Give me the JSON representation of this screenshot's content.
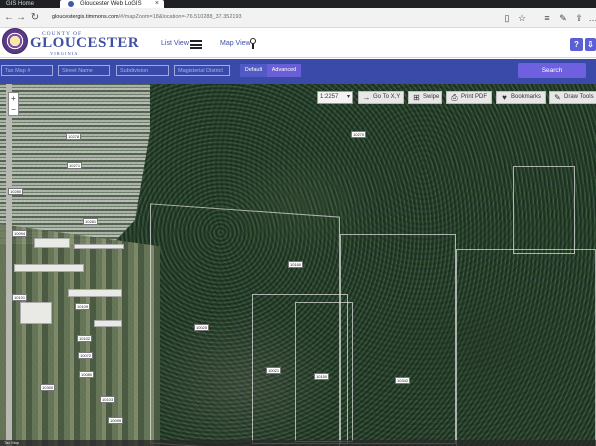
{
  "browser": {
    "tabs": [
      {
        "label": "GIS Home"
      },
      {
        "label": "Gloucester Web LoGIS"
      }
    ],
    "url_prefix": "gloucestergis.timmons.com",
    "url_rest": "/#/mapZoom=18&location=-76.510288_37.352193"
  },
  "header": {
    "brand_top": "COUNTY OF",
    "brand_name": "GLOUCESTER",
    "brand_sub": "VIRGINIA",
    "list_view_label": "List View",
    "map_view_label": "Map View",
    "help_glyph": "?"
  },
  "search": {
    "tax_map_placeholder": "Tax Map #",
    "street_name_placeholder": "Street Name",
    "subdivision_placeholder": "Subdivision",
    "magisterial_placeholder": "Magisterial District",
    "default_label": "Default",
    "advanced_label": "Advanced",
    "search_button": "Search"
  },
  "map": {
    "scale_value": "1:2257",
    "tools": {
      "goto_label": "Go To X,Y",
      "swipe_label": "Swipe",
      "print_label": "Print PDF",
      "bookmarks_label": "Bookmarks",
      "draw_label": "Draw Tools"
    },
    "parcel_labels": [
      "10270",
      "10278",
      "10271",
      "10280",
      "10281",
      "10025",
      "10021",
      "10160",
      "10150",
      "10342",
      "10109",
      "10102",
      "10072",
      "10080",
      "10103",
      "10099",
      "10094",
      "10101",
      "10300"
    ],
    "status_text": "Tax Map"
  }
}
